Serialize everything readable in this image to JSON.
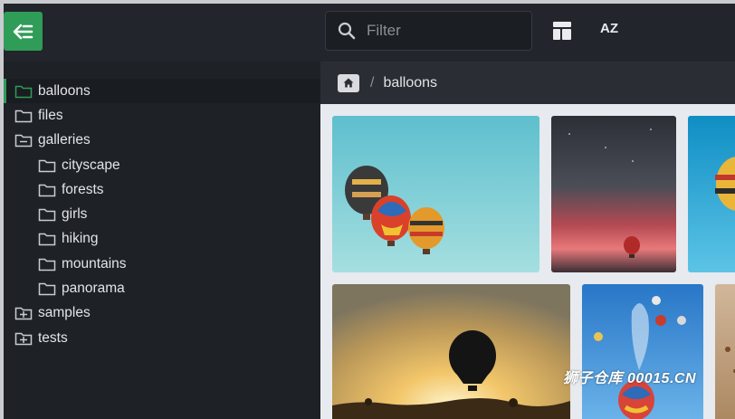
{
  "sidebar": {
    "back_icon": "arrow-left-collapse-icon",
    "items": [
      {
        "label": "balloons",
        "icon": "folder-icon",
        "active": true
      },
      {
        "label": "files",
        "icon": "folder-icon"
      },
      {
        "label": "galleries",
        "icon": "folder-minus-icon"
      },
      {
        "label": "cityscape",
        "icon": "folder-icon"
      },
      {
        "label": "forests",
        "icon": "folder-icon"
      },
      {
        "label": "girls",
        "icon": "folder-icon"
      },
      {
        "label": "hiking",
        "icon": "folder-icon"
      },
      {
        "label": "mountains",
        "icon": "folder-icon"
      },
      {
        "label": "panorama",
        "icon": "folder-icon"
      },
      {
        "label": "samples",
        "icon": "folder-plus-icon"
      },
      {
        "label": "tests",
        "icon": "folder-plus-icon"
      }
    ]
  },
  "header": {
    "filter_placeholder": "Filter",
    "layout_icon": "layout-grid-icon",
    "sort_label": "AZ"
  },
  "breadcrumb": {
    "home_icon": "home-icon",
    "separator": "/",
    "current": "balloons"
  },
  "gallery": {
    "images": [
      {
        "subject": "three balloons against teal sky"
      },
      {
        "subject": "balloon at dusk"
      },
      {
        "subject": "balloons over blue sky (cropped)"
      },
      {
        "subject": "balloon silhouette at sunset"
      },
      {
        "subject": "many balloons in blue sky"
      },
      {
        "subject": "desert balloons (cropped)"
      }
    ]
  },
  "watermark": "狮子仓库 00015.CN",
  "colors": {
    "accent": "#2f9c57",
    "sidebar_bg": "#1e2227",
    "gallery_bg": "#e7eaee"
  }
}
